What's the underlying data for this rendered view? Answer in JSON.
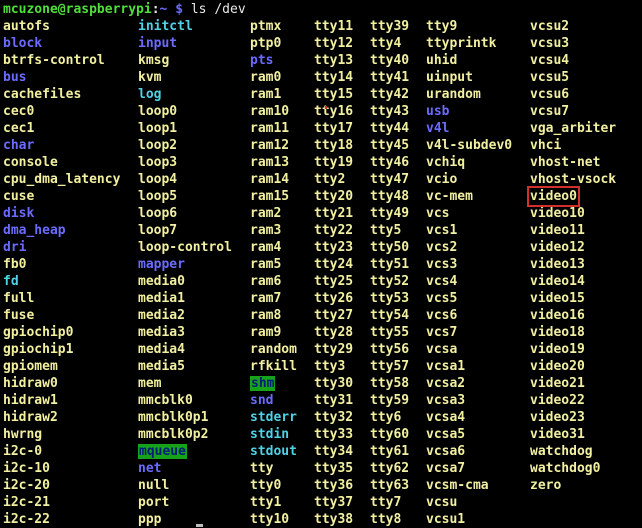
{
  "prompt": {
    "user_host": "mcuzone@raspberrypi",
    "path": "~",
    "symbol": "$",
    "command": "ls /dev"
  },
  "columns": [
    [
      {
        "name": "autofs",
        "kind": "dev"
      },
      {
        "name": "block",
        "kind": "dir"
      },
      {
        "name": "btrfs-control",
        "kind": "dev"
      },
      {
        "name": "bus",
        "kind": "dir"
      },
      {
        "name": "cachefiles",
        "kind": "dev"
      },
      {
        "name": "cec0",
        "kind": "dev"
      },
      {
        "name": "cec1",
        "kind": "dev"
      },
      {
        "name": "char",
        "kind": "dir"
      },
      {
        "name": "console",
        "kind": "dev"
      },
      {
        "name": "cpu_dma_latency",
        "kind": "dev"
      },
      {
        "name": "cuse",
        "kind": "dev"
      },
      {
        "name": "disk",
        "kind": "dir"
      },
      {
        "name": "dma_heap",
        "kind": "dir"
      },
      {
        "name": "dri",
        "kind": "dir"
      },
      {
        "name": "fb0",
        "kind": "dev"
      },
      {
        "name": "fd",
        "kind": "link"
      },
      {
        "name": "full",
        "kind": "dev"
      },
      {
        "name": "fuse",
        "kind": "dev"
      },
      {
        "name": "gpiochip0",
        "kind": "dev"
      },
      {
        "name": "gpiochip1",
        "kind": "dev"
      },
      {
        "name": "gpiomem",
        "kind": "dev"
      },
      {
        "name": "hidraw0",
        "kind": "dev"
      },
      {
        "name": "hidraw1",
        "kind": "dev"
      },
      {
        "name": "hidraw2",
        "kind": "dev"
      },
      {
        "name": "hwrng",
        "kind": "dev"
      },
      {
        "name": "i2c-0",
        "kind": "dev"
      },
      {
        "name": "i2c-10",
        "kind": "dev"
      },
      {
        "name": "i2c-20",
        "kind": "dev"
      },
      {
        "name": "i2c-21",
        "kind": "dev"
      },
      {
        "name": "i2c-22",
        "kind": "dev"
      }
    ],
    [
      {
        "name": "initctl",
        "kind": "link"
      },
      {
        "name": "input",
        "kind": "dir"
      },
      {
        "name": "kmsg",
        "kind": "dev"
      },
      {
        "name": "kvm",
        "kind": "dev"
      },
      {
        "name": "log",
        "kind": "link"
      },
      {
        "name": "loop0",
        "kind": "dev"
      },
      {
        "name": "loop1",
        "kind": "dev"
      },
      {
        "name": "loop2",
        "kind": "dev"
      },
      {
        "name": "loop3",
        "kind": "dev"
      },
      {
        "name": "loop4",
        "kind": "dev"
      },
      {
        "name": "loop5",
        "kind": "dev"
      },
      {
        "name": "loop6",
        "kind": "dev"
      },
      {
        "name": "loop7",
        "kind": "dev"
      },
      {
        "name": "loop-control",
        "kind": "dev"
      },
      {
        "name": "mapper",
        "kind": "dir"
      },
      {
        "name": "media0",
        "kind": "dev"
      },
      {
        "name": "media1",
        "kind": "dev"
      },
      {
        "name": "media2",
        "kind": "dev"
      },
      {
        "name": "media3",
        "kind": "dev"
      },
      {
        "name": "media4",
        "kind": "dev"
      },
      {
        "name": "media5",
        "kind": "dev"
      },
      {
        "name": "mem",
        "kind": "dev"
      },
      {
        "name": "mmcblk0",
        "kind": "dev"
      },
      {
        "name": "mmcblk0p1",
        "kind": "dev"
      },
      {
        "name": "mmcblk0p2",
        "kind": "dev"
      },
      {
        "name": "mqueue",
        "kind": "sticky"
      },
      {
        "name": "net",
        "kind": "dir"
      },
      {
        "name": "null",
        "kind": "dev"
      },
      {
        "name": "port",
        "kind": "dev"
      },
      {
        "name": "ppp",
        "kind": "dev"
      }
    ],
    [
      {
        "name": "ptmx",
        "kind": "dev"
      },
      {
        "name": "ptp0",
        "kind": "dev"
      },
      {
        "name": "pts",
        "kind": "dir"
      },
      {
        "name": "ram0",
        "kind": "dev"
      },
      {
        "name": "ram1",
        "kind": "dev"
      },
      {
        "name": "ram10",
        "kind": "dev"
      },
      {
        "name": "ram11",
        "kind": "dev"
      },
      {
        "name": "ram12",
        "kind": "dev"
      },
      {
        "name": "ram13",
        "kind": "dev"
      },
      {
        "name": "ram14",
        "kind": "dev"
      },
      {
        "name": "ram15",
        "kind": "dev"
      },
      {
        "name": "ram2",
        "kind": "dev"
      },
      {
        "name": "ram3",
        "kind": "dev"
      },
      {
        "name": "ram4",
        "kind": "dev"
      },
      {
        "name": "ram5",
        "kind": "dev"
      },
      {
        "name": "ram6",
        "kind": "dev"
      },
      {
        "name": "ram7",
        "kind": "dev"
      },
      {
        "name": "ram8",
        "kind": "dev"
      },
      {
        "name": "ram9",
        "kind": "dev"
      },
      {
        "name": "random",
        "kind": "dev"
      },
      {
        "name": "rfkill",
        "kind": "dev"
      },
      {
        "name": "shm",
        "kind": "sticky"
      },
      {
        "name": "snd",
        "kind": "dir"
      },
      {
        "name": "stderr",
        "kind": "link"
      },
      {
        "name": "stdin",
        "kind": "link"
      },
      {
        "name": "stdout",
        "kind": "link"
      },
      {
        "name": "tty",
        "kind": "dev"
      },
      {
        "name": "tty0",
        "kind": "dev"
      },
      {
        "name": "tty1",
        "kind": "dev"
      },
      {
        "name": "tty10",
        "kind": "dev"
      }
    ],
    [
      {
        "name": "tty11",
        "kind": "dev"
      },
      {
        "name": "tty12",
        "kind": "dev"
      },
      {
        "name": "tty13",
        "kind": "dev"
      },
      {
        "name": "tty14",
        "kind": "dev"
      },
      {
        "name": "tty15",
        "kind": "dev"
      },
      {
        "name": "tty16",
        "kind": "dev"
      },
      {
        "name": "tty17",
        "kind": "dev"
      },
      {
        "name": "tty18",
        "kind": "dev"
      },
      {
        "name": "tty19",
        "kind": "dev"
      },
      {
        "name": "tty2",
        "kind": "dev"
      },
      {
        "name": "tty20",
        "kind": "dev"
      },
      {
        "name": "tty21",
        "kind": "dev"
      },
      {
        "name": "tty22",
        "kind": "dev"
      },
      {
        "name": "tty23",
        "kind": "dev"
      },
      {
        "name": "tty24",
        "kind": "dev"
      },
      {
        "name": "tty25",
        "kind": "dev"
      },
      {
        "name": "tty26",
        "kind": "dev"
      },
      {
        "name": "tty27",
        "kind": "dev"
      },
      {
        "name": "tty28",
        "kind": "dev"
      },
      {
        "name": "tty29",
        "kind": "dev"
      },
      {
        "name": "tty3",
        "kind": "dev"
      },
      {
        "name": "tty30",
        "kind": "dev"
      },
      {
        "name": "tty31",
        "kind": "dev"
      },
      {
        "name": "tty32",
        "kind": "dev"
      },
      {
        "name": "tty33",
        "kind": "dev"
      },
      {
        "name": "tty34",
        "kind": "dev"
      },
      {
        "name": "tty35",
        "kind": "dev"
      },
      {
        "name": "tty36",
        "kind": "dev"
      },
      {
        "name": "tty37",
        "kind": "dev"
      },
      {
        "name": "tty38",
        "kind": "dev"
      }
    ],
    [
      {
        "name": "tty39",
        "kind": "dev"
      },
      {
        "name": "tty4",
        "kind": "dev"
      },
      {
        "name": "tty40",
        "kind": "dev"
      },
      {
        "name": "tty41",
        "kind": "dev"
      },
      {
        "name": "tty42",
        "kind": "dev"
      },
      {
        "name": "tty43",
        "kind": "dev"
      },
      {
        "name": "tty44",
        "kind": "dev"
      },
      {
        "name": "tty45",
        "kind": "dev"
      },
      {
        "name": "tty46",
        "kind": "dev"
      },
      {
        "name": "tty47",
        "kind": "dev"
      },
      {
        "name": "tty48",
        "kind": "dev"
      },
      {
        "name": "tty49",
        "kind": "dev"
      },
      {
        "name": "tty5",
        "kind": "dev"
      },
      {
        "name": "tty50",
        "kind": "dev"
      },
      {
        "name": "tty51",
        "kind": "dev"
      },
      {
        "name": "tty52",
        "kind": "dev"
      },
      {
        "name": "tty53",
        "kind": "dev"
      },
      {
        "name": "tty54",
        "kind": "dev"
      },
      {
        "name": "tty55",
        "kind": "dev"
      },
      {
        "name": "tty56",
        "kind": "dev"
      },
      {
        "name": "tty57",
        "kind": "dev"
      },
      {
        "name": "tty58",
        "kind": "dev"
      },
      {
        "name": "tty59",
        "kind": "dev"
      },
      {
        "name": "tty6",
        "kind": "dev"
      },
      {
        "name": "tty60",
        "kind": "dev"
      },
      {
        "name": "tty61",
        "kind": "dev"
      },
      {
        "name": "tty62",
        "kind": "dev"
      },
      {
        "name": "tty63",
        "kind": "dev"
      },
      {
        "name": "tty7",
        "kind": "dev"
      },
      {
        "name": "tty8",
        "kind": "dev"
      }
    ],
    [
      {
        "name": "tty9",
        "kind": "dev"
      },
      {
        "name": "ttyprintk",
        "kind": "dev"
      },
      {
        "name": "uhid",
        "kind": "dev"
      },
      {
        "name": "uinput",
        "kind": "dev"
      },
      {
        "name": "urandom",
        "kind": "dev"
      },
      {
        "name": "usb",
        "kind": "dir"
      },
      {
        "name": "v4l",
        "kind": "dir"
      },
      {
        "name": "v4l-subdev0",
        "kind": "dev"
      },
      {
        "name": "vchiq",
        "kind": "dev"
      },
      {
        "name": "vcio",
        "kind": "dev"
      },
      {
        "name": "vc-mem",
        "kind": "dev"
      },
      {
        "name": "vcs",
        "kind": "dev"
      },
      {
        "name": "vcs1",
        "kind": "dev"
      },
      {
        "name": "vcs2",
        "kind": "dev"
      },
      {
        "name": "vcs3",
        "kind": "dev"
      },
      {
        "name": "vcs4",
        "kind": "dev"
      },
      {
        "name": "vcs5",
        "kind": "dev"
      },
      {
        "name": "vcs6",
        "kind": "dev"
      },
      {
        "name": "vcs7",
        "kind": "dev"
      },
      {
        "name": "vcsa",
        "kind": "dev"
      },
      {
        "name": "vcsa1",
        "kind": "dev"
      },
      {
        "name": "vcsa2",
        "kind": "dev"
      },
      {
        "name": "vcsa3",
        "kind": "dev"
      },
      {
        "name": "vcsa4",
        "kind": "dev"
      },
      {
        "name": "vcsa5",
        "kind": "dev"
      },
      {
        "name": "vcsa6",
        "kind": "dev"
      },
      {
        "name": "vcsa7",
        "kind": "dev"
      },
      {
        "name": "vcsm-cma",
        "kind": "dev"
      },
      {
        "name": "vcsu",
        "kind": "dev"
      },
      {
        "name": "vcsu1",
        "kind": "dev"
      }
    ],
    [
      {
        "name": "vcsu2",
        "kind": "dev"
      },
      {
        "name": "vcsu3",
        "kind": "dev"
      },
      {
        "name": "vcsu4",
        "kind": "dev"
      },
      {
        "name": "vcsu5",
        "kind": "dev"
      },
      {
        "name": "vcsu6",
        "kind": "dev"
      },
      {
        "name": "vcsu7",
        "kind": "dev"
      },
      {
        "name": "vga_arbiter",
        "kind": "dev"
      },
      {
        "name": "vhci",
        "kind": "dev"
      },
      {
        "name": "vhost-net",
        "kind": "dev"
      },
      {
        "name": "vhost-vsock",
        "kind": "dev"
      },
      {
        "name": "video0",
        "kind": "dev",
        "highlight": true
      },
      {
        "name": "video10",
        "kind": "dev"
      },
      {
        "name": "video11",
        "kind": "dev"
      },
      {
        "name": "video12",
        "kind": "dev"
      },
      {
        "name": "video13",
        "kind": "dev"
      },
      {
        "name": "video14",
        "kind": "dev"
      },
      {
        "name": "video15",
        "kind": "dev"
      },
      {
        "name": "video16",
        "kind": "dev"
      },
      {
        "name": "video18",
        "kind": "dev"
      },
      {
        "name": "video19",
        "kind": "dev"
      },
      {
        "name": "video20",
        "kind": "dev"
      },
      {
        "name": "video21",
        "kind": "dev"
      },
      {
        "name": "video22",
        "kind": "dev"
      },
      {
        "name": "video23",
        "kind": "dev"
      },
      {
        "name": "video31",
        "kind": "dev"
      },
      {
        "name": "watchdog",
        "kind": "dev"
      },
      {
        "name": "watchdog0",
        "kind": "dev"
      },
      {
        "name": "zero",
        "kind": "dev"
      }
    ]
  ],
  "colors": {
    "background": "#000000",
    "device": "#f2f0a0",
    "directory": "#6b6bff",
    "symlink": "#4fd2e6",
    "sticky_bg": "#16a31a",
    "highlight_box": "#d0312d",
    "prompt_user": "#4fdf3a"
  }
}
